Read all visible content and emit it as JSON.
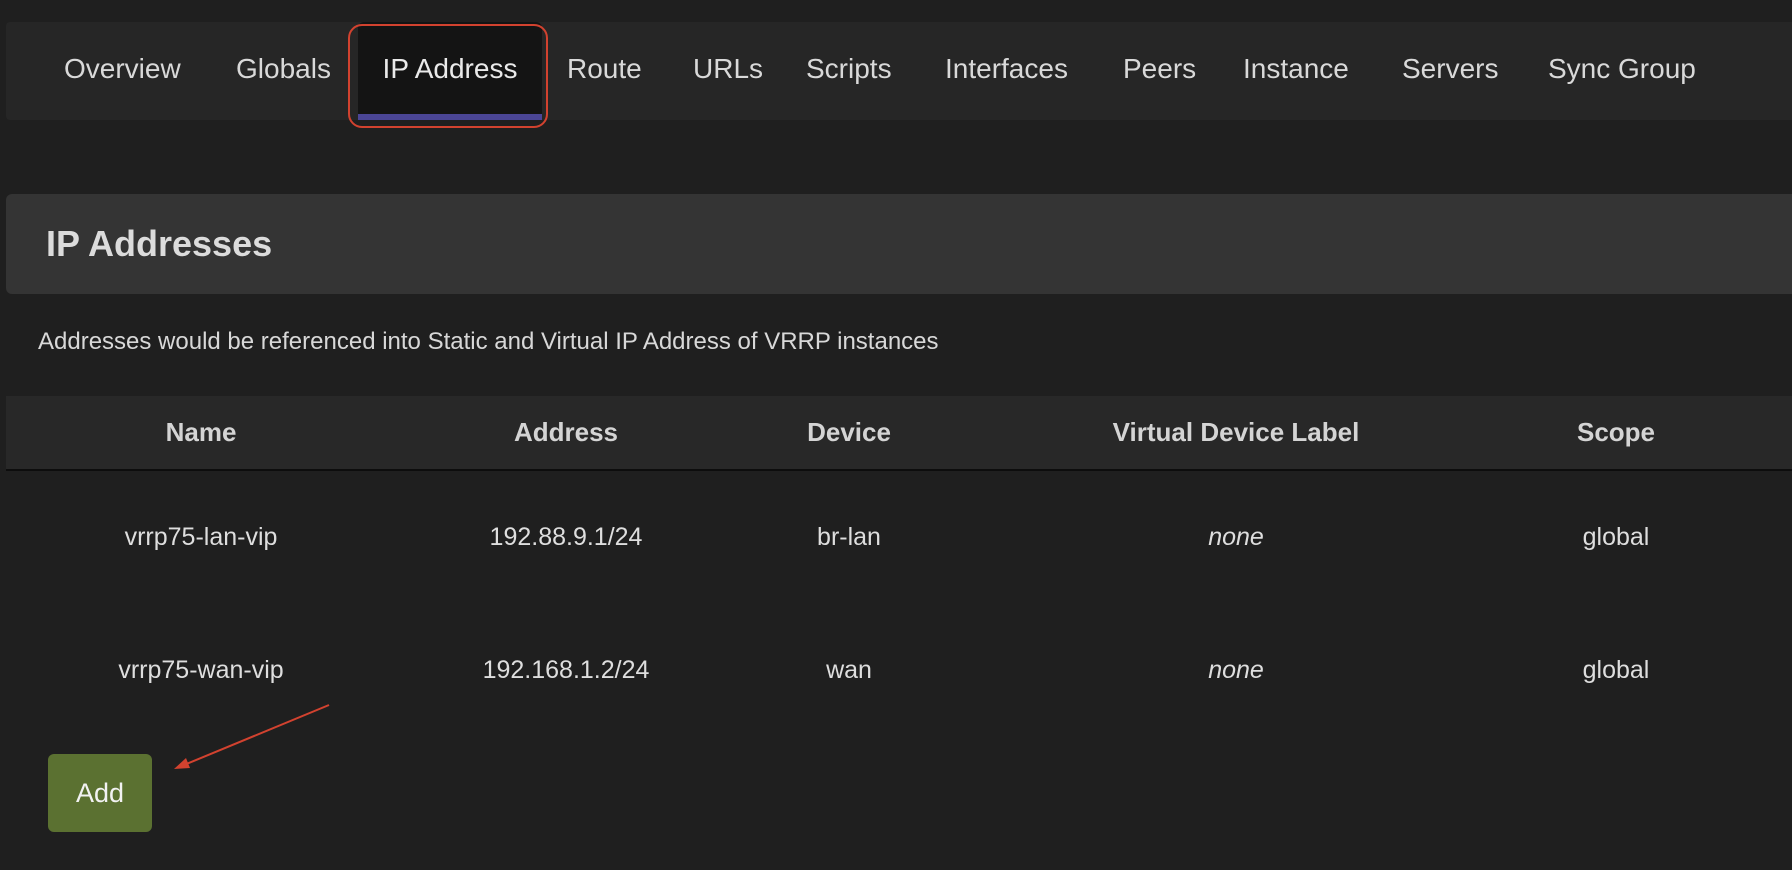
{
  "tabs": [
    {
      "label": "Overview"
    },
    {
      "label": "Globals"
    },
    {
      "label": "IP Address",
      "active": true
    },
    {
      "label": "Route"
    },
    {
      "label": "URLs"
    },
    {
      "label": "Scripts"
    },
    {
      "label": "Interfaces"
    },
    {
      "label": "Peers"
    },
    {
      "label": "Instance"
    },
    {
      "label": "Servers"
    },
    {
      "label": "Sync Group"
    }
  ],
  "section": {
    "title": "IP Addresses",
    "description": "Addresses would be referenced into Static and Virtual IP Address of VRRP instances"
  },
  "table": {
    "columns": [
      "Name",
      "Address",
      "Device",
      "Virtual Device Label",
      "Scope"
    ],
    "rows": [
      [
        "vrrp75-lan-vip",
        "192.88.9.1/24",
        "br-lan",
        "none",
        "global"
      ],
      [
        "vrrp75-wan-vip",
        "192.168.1.2/24",
        "wan",
        "none",
        "global"
      ]
    ]
  },
  "actions": {
    "add_label": "Add"
  },
  "colors": {
    "background": "#1f1f1f",
    "tab_active_underline": "#4b4696",
    "annotation_red": "#d2422f",
    "add_button": "#5b7131"
  }
}
